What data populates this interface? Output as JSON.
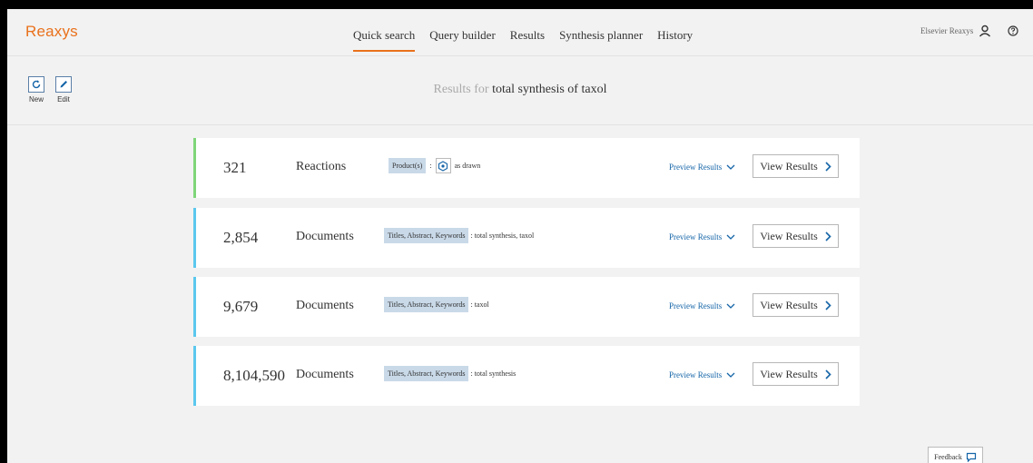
{
  "app": {
    "logo": "Reaxys"
  },
  "nav": {
    "items": [
      {
        "label": "Quick search",
        "active": true
      },
      {
        "label": "Query builder",
        "active": false
      },
      {
        "label": "Results",
        "active": false
      },
      {
        "label": "Synthesis planner",
        "active": false
      },
      {
        "label": "History",
        "active": false
      }
    ]
  },
  "user": {
    "name": "Elsevier Reaxys",
    "icon": "user-icon",
    "help_icon": "help-icon"
  },
  "toolbar": {
    "new_label": "New",
    "edit_label": "Edit",
    "results_prefix": "Results for",
    "query": "total synthesis of taxol"
  },
  "cards": [
    {
      "count": "321",
      "type": "Reactions",
      "tag": "Product(s)",
      "separator": ":",
      "criteria": "as drawn",
      "accent": "#7fd67a",
      "preview_label": "Preview Results",
      "view_label": "View Results"
    },
    {
      "count": "2,854",
      "type": "Documents",
      "tag": "Titles, Abstract, Keywords",
      "criteria": ": total synthesis, taxol",
      "accent": "#5bc8ee",
      "preview_label": "Preview Results",
      "view_label": "View Results"
    },
    {
      "count": "9,679",
      "type": "Documents",
      "tag": "Titles, Abstract, Keywords",
      "criteria": ": taxol",
      "accent": "#5bc8ee",
      "preview_label": "Preview Results",
      "view_label": "View Results"
    },
    {
      "count": "8,104,590",
      "type": "Documents",
      "tag": "Titles, Abstract, Keywords",
      "criteria": ": total synthesis",
      "accent": "#5bc8ee",
      "preview_label": "Preview Results",
      "view_label": "View Results"
    }
  ],
  "feedback": {
    "label": "Feedback"
  },
  "colors": {
    "brand": "#e9711c",
    "link": "#1565a8",
    "tag_bg": "#c9d9e8"
  }
}
